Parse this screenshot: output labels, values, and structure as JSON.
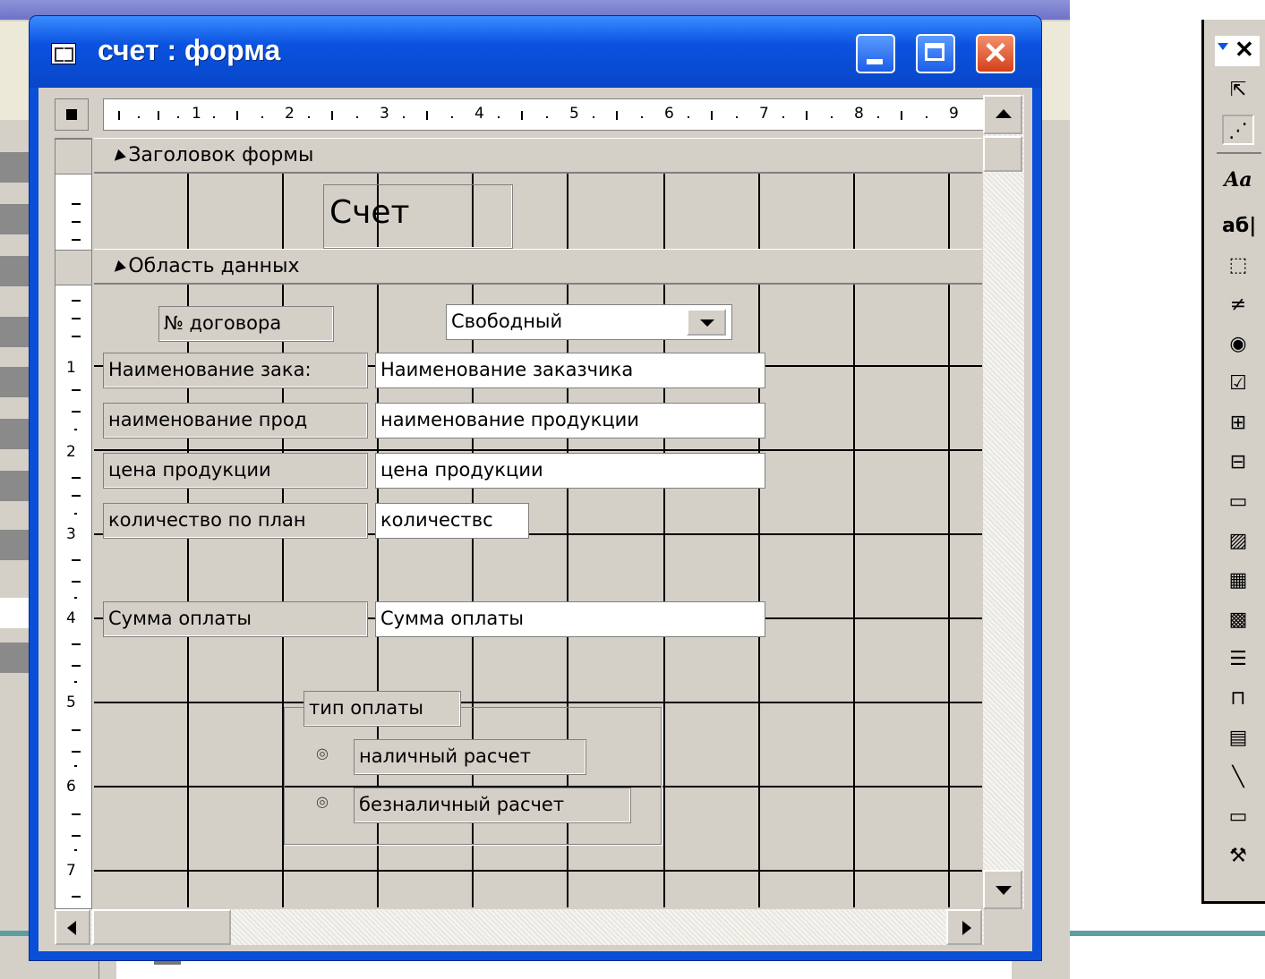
{
  "window": {
    "title": "счет : форма"
  },
  "ruler": {
    "h_marks": [
      "1",
      "2",
      "3",
      "4",
      "5",
      "6",
      "7",
      "8",
      "9"
    ],
    "v_marks": [
      "1",
      "2",
      "3",
      "4",
      "5",
      "6",
      "7"
    ]
  },
  "sections": {
    "header": "Заголовок формы",
    "detail": "Область данных"
  },
  "form": {
    "title_label": "Счет",
    "contract_label": "№ договора",
    "status_combo": "Свободный",
    "fields": [
      {
        "label": "Наименование зака:",
        "value": "Наименование заказчика"
      },
      {
        "label": "наименование прод",
        "value": "наименование продукции"
      },
      {
        "label": "цена продукции",
        "value": "цена продукции"
      },
      {
        "label": "количество по план",
        "value": "количествс"
      },
      {
        "label": "Сумма оплаты",
        "value": "Сумма оплаты"
      }
    ],
    "payment_group": {
      "label": "тип оплаты",
      "options": [
        "наличный расчет",
        "безналичный расчет"
      ]
    }
  },
  "toolbox": {
    "tools": [
      "pointer-icon",
      "wizard-icon",
      "Aa",
      "аб|",
      "option-group-icon",
      "toggle-icon",
      "radio-icon",
      "checkbox-icon",
      "combo-icon",
      "list-icon",
      "button-icon",
      "image-icon",
      "unbound-frame-icon",
      "bound-frame-icon",
      "page-break-icon",
      "tab-icon",
      "subform-icon",
      "line-icon",
      "rectangle-icon",
      "more-tools-icon"
    ]
  },
  "colors": {
    "titlebar": "#0a52e0",
    "close": "#d4401c",
    "face": "#d4d0c8",
    "accent_band": "#6c72c8"
  }
}
